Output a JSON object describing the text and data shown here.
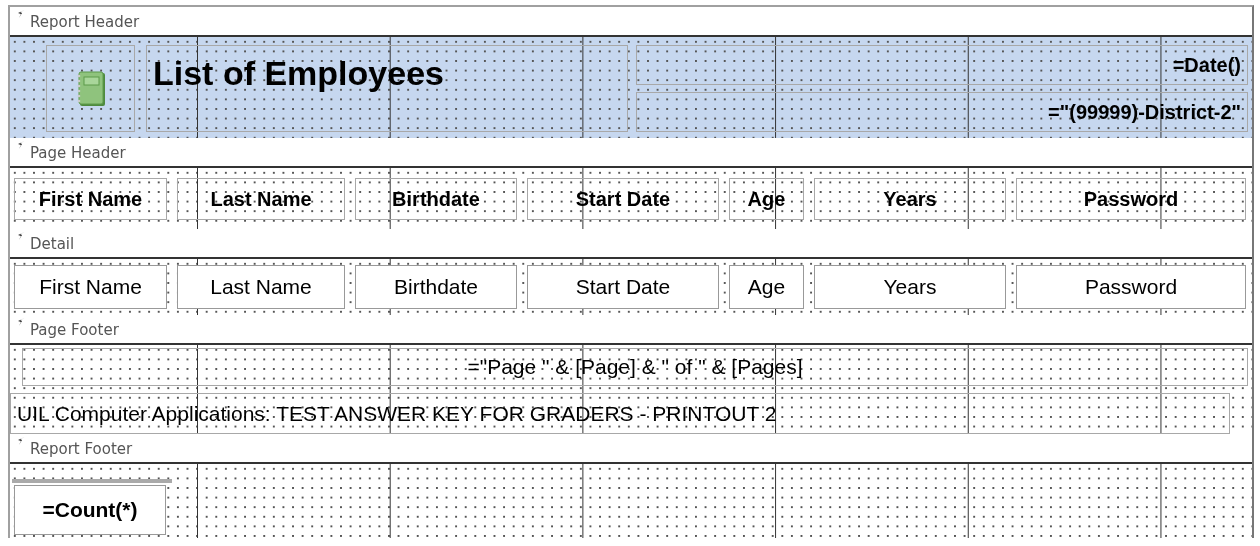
{
  "sections": [
    {
      "title": "Report Header",
      "selected": true,
      "controls": [
        {
          "kind": "logo"
        },
        {
          "kind": "title",
          "text": "List of Employees"
        },
        {
          "kind": "expr",
          "text": "=Date()"
        },
        {
          "kind": "expr",
          "text": "=\"(99999)-District-2\""
        }
      ]
    },
    {
      "title": "Page Header",
      "selected": false,
      "controls": [
        {
          "kind": "label",
          "text": "First Name"
        },
        {
          "kind": "label",
          "text": "Last Name"
        },
        {
          "kind": "label",
          "text": "Birthdate"
        },
        {
          "kind": "label",
          "text": "Start Date"
        },
        {
          "kind": "label",
          "text": "Age"
        },
        {
          "kind": "label",
          "text": "Years"
        },
        {
          "kind": "label",
          "text": "Password"
        }
      ]
    },
    {
      "title": "Detail",
      "selected": false,
      "controls": [
        {
          "kind": "textbox",
          "text": "First Name"
        },
        {
          "kind": "textbox",
          "text": "Last Name"
        },
        {
          "kind": "textbox",
          "text": "Birthdate"
        },
        {
          "kind": "textbox",
          "text": "Start Date"
        },
        {
          "kind": "textbox",
          "text": "Age"
        },
        {
          "kind": "textbox",
          "text": "Years"
        },
        {
          "kind": "textbox",
          "text": "Password"
        }
      ]
    },
    {
      "title": "Page Footer",
      "selected": false,
      "controls": [
        {
          "kind": "plain-center",
          "text": "=\"Page \" & [Page] & \" of \" & [Pages]"
        },
        {
          "kind": "plain-left",
          "text": "UIL Computer Applications:  TEST ANSWER KEY FOR GRADERS - PRINTOUT 2"
        }
      ]
    },
    {
      "title": "Report Footer",
      "selected": false,
      "controls": [
        {
          "kind": "textbox-bold",
          "text": "=Count(*)"
        }
      ]
    }
  ]
}
